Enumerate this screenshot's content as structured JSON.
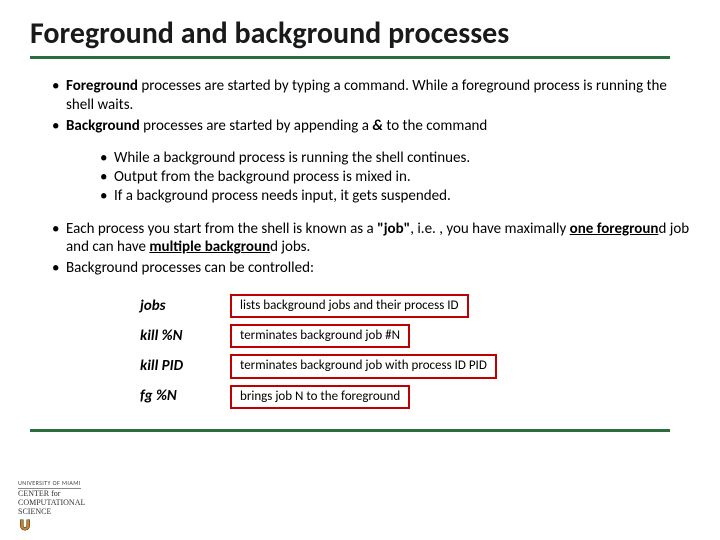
{
  "title": "Foreground and background processes",
  "bullets1": {
    "fg_bold": "Foreground",
    "fg_rest": " processes are started by typing a command. While a foreground process is running the shell waits.",
    "bg_bold": "Background",
    "bg_rest1": " processes are started by appending a ",
    "bg_amp": "&",
    "bg_rest2": " to the command"
  },
  "sub": {
    "s1": "While a background process is running the shell continues.",
    "s2": "Output from the background process is mixed in.",
    "s3": "If a background process needs input, it gets suspended."
  },
  "bullets2": {
    "job1_a": "Each process you start from the shell is known as a ",
    "job1_b": "\"job\"",
    "job1_c": ", i.e. , you have maximally ",
    "job1_d": "one foregroun",
    "job1_e": "d job and can have ",
    "job1_f": "multiple backgroun",
    "job1_g": "d jobs.",
    "ctrl": "Background processes can be controlled:"
  },
  "cmds": [
    {
      "name": "jobs",
      "desc": "lists background jobs and their process ID"
    },
    {
      "name": "kill %N",
      "desc": "terminates background job #N"
    },
    {
      "name": "kill PID",
      "desc": "terminates background job with process ID PID"
    },
    {
      "name": "fg %N",
      "desc": "brings job N to the foreground"
    }
  ],
  "footer": {
    "inst": "UNIVERSITY OF MIAMI",
    "center1": "CENTER for",
    "center2": "COMPUTATIONAL",
    "center3": "SCIENCE"
  }
}
